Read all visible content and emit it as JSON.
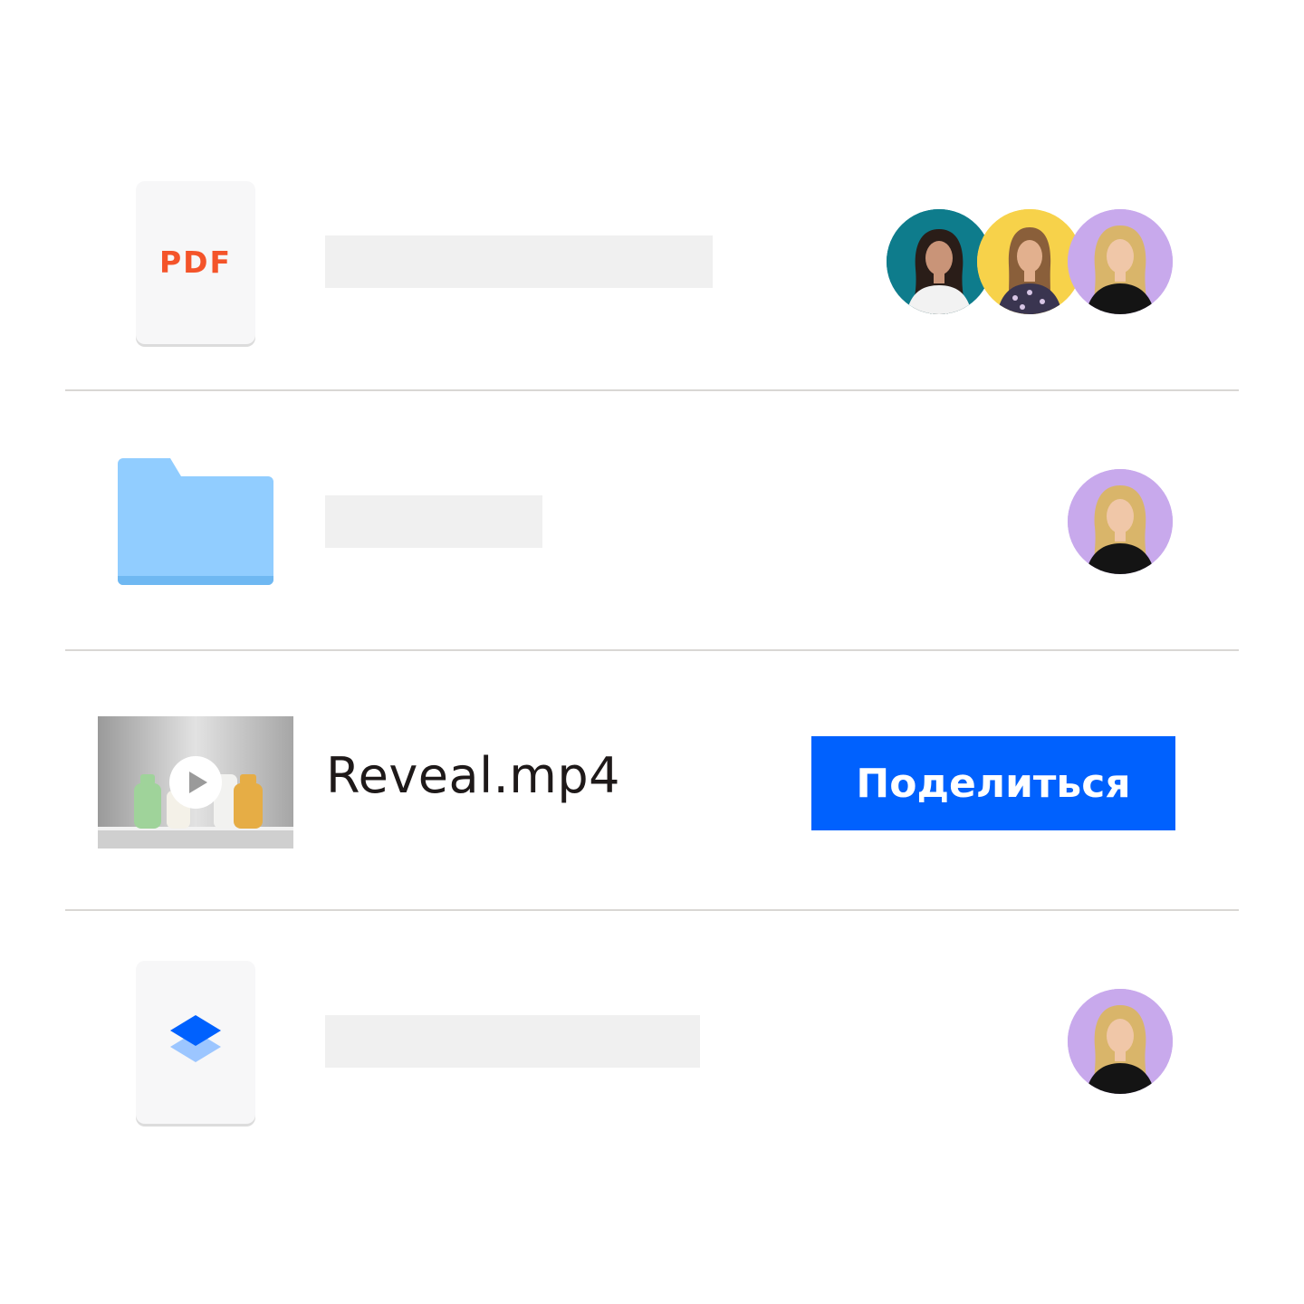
{
  "files": [
    {
      "type": "pdf",
      "icon_text": "PDF",
      "accent_color": "#f4542a",
      "shared_with": [
        "avatar-teal",
        "avatar-yellow",
        "avatar-purple"
      ]
    },
    {
      "type": "folder",
      "icon": "folder-icon",
      "folder_color": "#91cdff",
      "shared_with": [
        "avatar-purple"
      ]
    },
    {
      "type": "video",
      "icon": "play-icon",
      "name": "Reveal.mp4",
      "action_label": "Поделиться",
      "action_color": "#0061fe"
    },
    {
      "type": "dropbox-file",
      "icon": "dropbox-logo-icon",
      "logo_color": "#0061fe",
      "shared_with": [
        "avatar-purple"
      ]
    }
  ],
  "avatar_colors": {
    "teal": "#0e7c8c",
    "yellow": "#f7d24a",
    "purple": "#c8a9ec"
  }
}
